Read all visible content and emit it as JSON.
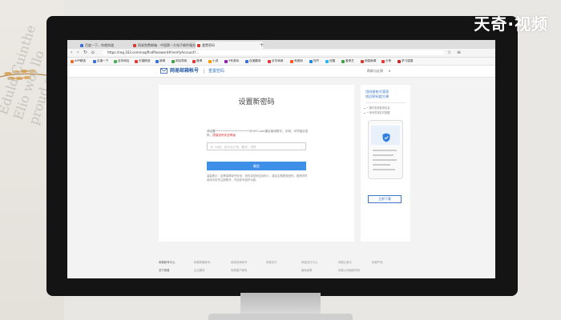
{
  "watermark": "天奇·视频",
  "background_text": [
    "Eduld Cuinthe",
    "Elio wol llo",
    "proud o"
  ],
  "browser": {
    "tabs": [
      {
        "label": "百度一下，你就知道",
        "favicon_color": "#3b6fd6"
      },
      {
        "label": "网易免费邮箱 - 中国第一大电子邮件服务商",
        "favicon_color": "#d33b33"
      },
      {
        "label": "重置密码",
        "favicon_color": "#d33b33",
        "active": true
      }
    ],
    "new_tab": "+",
    "url": "https://reg.163.com/naq/findPassword#/verifyAccount?...",
    "bookmarks": [
      "APP精选",
      "百度一下",
      "百年网址",
      "天猫精选",
      "新闻",
      "网址导航",
      "微博",
      "小说",
      "9号游戏",
      "百度翻译",
      "京东商城",
      "淘宝网",
      "知乎",
      "优酷",
      "爱奇艺",
      "网易新闻",
      "头条",
      "学习强国"
    ]
  },
  "header": {
    "brand": "网易邮箱帐号",
    "page_name": "重置密码",
    "help": "帮助与反馈",
    "help_caret": "▾"
  },
  "card": {
    "title": "设置新密码",
    "desc_prefix": "请设置",
    "masked_account": "••••••••••••••••••••@163.com",
    "desc_suffix": "建议使用数字、字母、字符组合密码，",
    "desc_highlight": "提高密码安全等级",
    "input_placeholder": "6~16位，区分大小写，数字、字符",
    "confirm": "确定",
    "tips": "温馨提示：如需保障帐号安全，请勿将密码告诉他人，建议定期更换密码，推荐同时使用手机号注册账号，开启帐号保护功能。"
  },
  "promo": {
    "title_line1": "用网易帐号管家",
    "title_line2": "找回密码超方便",
    "items": [
      "• 随时查看登录信息",
      "• 帐号异常实时提醒"
    ],
    "download": "立即下载"
  },
  "footer": {
    "row1": [
      "网易帐号中心",
      "网易邮箱帐号",
      "网易游戏帐号",
      "网易支付",
      "网易支付中心",
      "网易云音乐",
      "网易严选"
    ],
    "row2": [
      "关于网易",
      "企业服务",
      "网易客户服务",
      "隐私政策",
      "网易公司版权所有"
    ]
  },
  "colors": {
    "accent": "#3d8fe8",
    "brand": "#2a5fa8",
    "link": "#3a77c8",
    "warning": "#d33333"
  }
}
